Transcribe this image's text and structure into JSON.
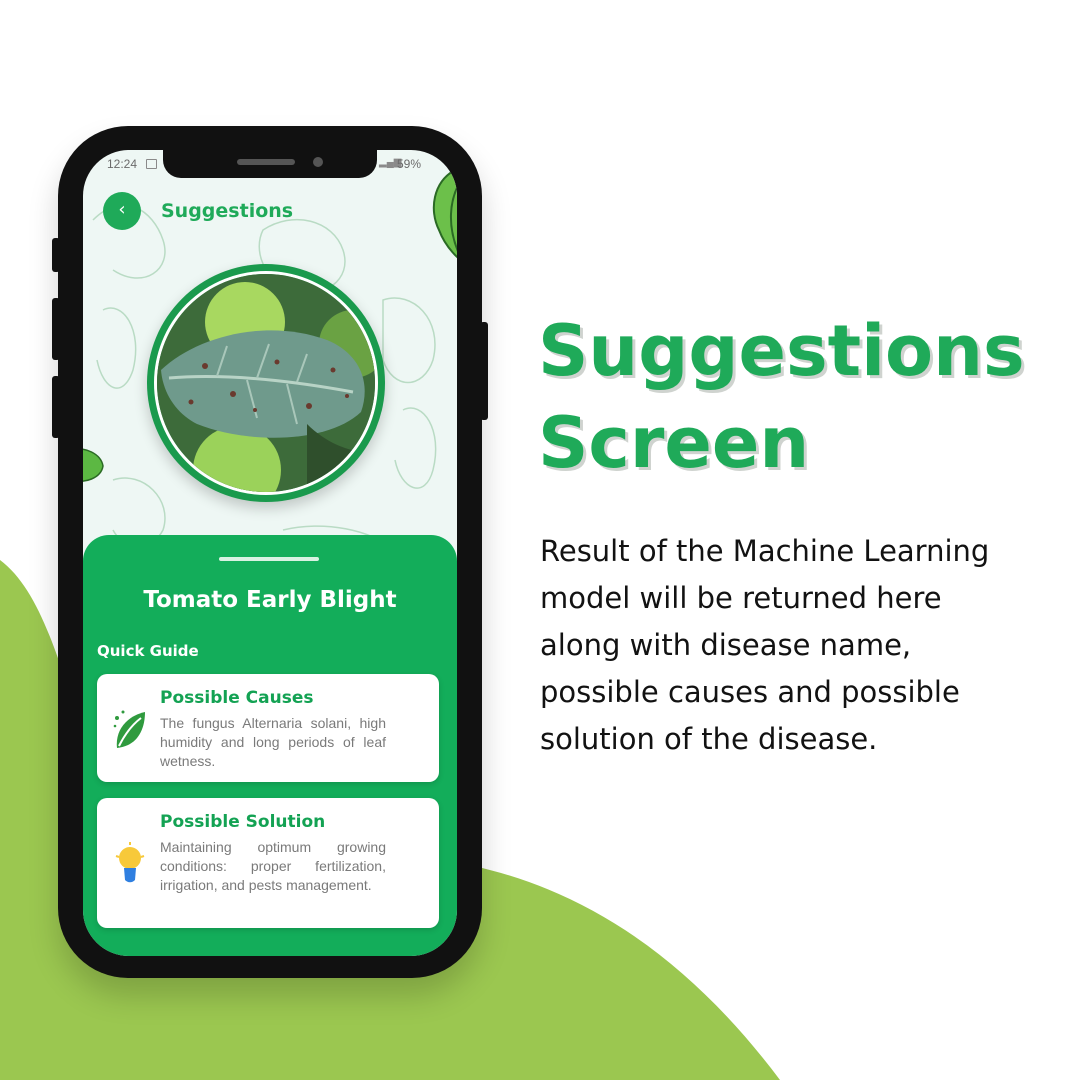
{
  "colors": {
    "accent": "#1faa59",
    "panel": "#13ad5a",
    "blob": "#9bc750",
    "text_dark": "#121212"
  },
  "headline": {
    "line1": "Suggestions",
    "line2": "Screen"
  },
  "description": "Result of the Machine Learning model will be returned here along with disease name, possible causes and possible solution of the disease.",
  "phone": {
    "status": {
      "time": "12:24",
      "battery": "59%"
    },
    "app": {
      "title": "Suggestions",
      "back_icon": "chevron-left-icon",
      "disease_name": "Tomato Early Blight",
      "section_label": "Quick Guide",
      "cards": [
        {
          "title": "Possible Causes",
          "icon": "leaf-icon",
          "text": "The fungus Alternaria solani, high humidity and long periods of leaf wetness."
        },
        {
          "title": "Possible Solution",
          "icon": "lightbulb-icon",
          "text": "Maintaining optimum growing conditions: proper fertilization, irrigation, and pests management."
        }
      ]
    }
  }
}
